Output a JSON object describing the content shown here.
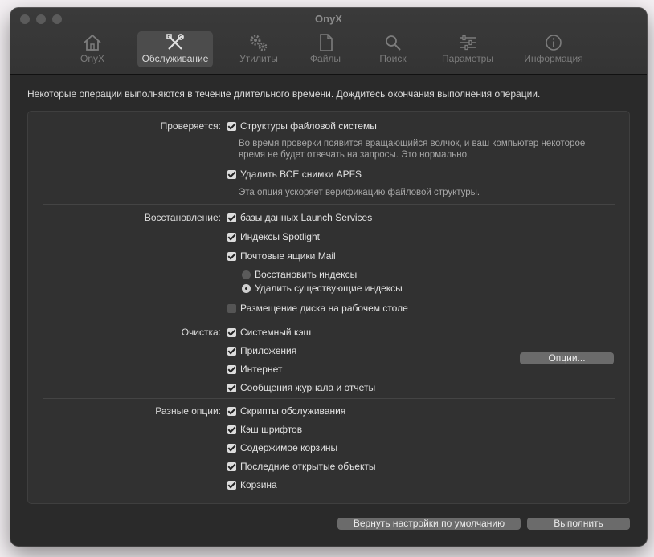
{
  "window": {
    "title": "OnyX"
  },
  "tabs": [
    {
      "label": "OnyX",
      "icon": "house-icon"
    },
    {
      "label": "Обслуживание",
      "icon": "tools-icon"
    },
    {
      "label": "Утилиты",
      "icon": "gears-icon"
    },
    {
      "label": "Файлы",
      "icon": "document-icon"
    },
    {
      "label": "Поиск",
      "icon": "magnifier-icon"
    },
    {
      "label": "Параметры",
      "icon": "sliders-icon"
    },
    {
      "label": "Информация",
      "icon": "info-icon"
    }
  ],
  "active_tab": "Обслуживание",
  "notice": "Некоторые операции выполняются в течение длительного времени. Дождитесь окончания выполнения операции.",
  "verify": {
    "label": "Проверяется:",
    "item1": "Структуры файловой системы",
    "item1_checked": true,
    "hint1_line1": "Во время проверки появится вращающийся волчок, и ваш компьютер некоторое",
    "hint1_line2": "время не будет отвечать на запросы. Это нормально.",
    "item2": "Удалить ВСЕ снимки APFS",
    "item2_checked": true,
    "hint2": "Эта опция ускоряет верификацию файловой структуры."
  },
  "rebuild": {
    "label": "Восстановление:",
    "launch_services": "базы данных Launch Services",
    "spotlight": "Индексы Spotlight",
    "mail": "Почтовые ящики Mail",
    "radio_rebuild": "Восстановить индексы",
    "radio_delete": "Удалить существующие индексы",
    "radio_selected": "Удалить существующие индексы",
    "desktop": "Размещение диска на рабочем столе",
    "desktop_checked": false
  },
  "clean": {
    "label": "Очистка:",
    "system_cache": "Системный кэш",
    "apps": "Приложения",
    "internet": "Интернет",
    "logs": "Сообщения журнала и отчеты",
    "options_button": "Опции..."
  },
  "misc": {
    "label": "Разные опции:",
    "scripts": "Скрипты обслуживания",
    "fonts": "Кэш шрифтов",
    "trash_contents": "Содержимое корзины",
    "recent": "Последние открытые объекты",
    "trash": "Корзина"
  },
  "footer": {
    "reset_button": "Вернуть настройки по умолчанию",
    "run_button": "Выполнить"
  }
}
